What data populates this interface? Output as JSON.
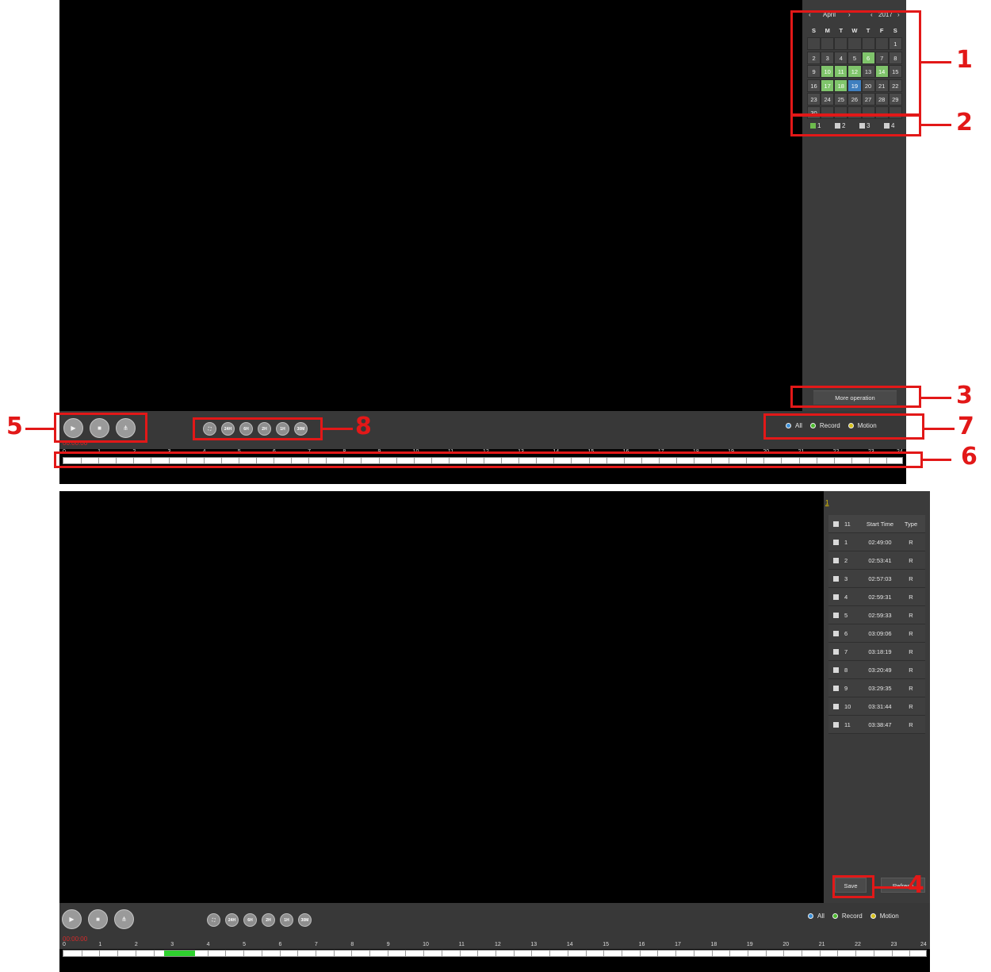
{
  "header_cut_text": "… ‹ … ›",
  "calendar": {
    "month": "April",
    "year": "2017",
    "prev_month": "‹",
    "next_month": "›",
    "prev_year": "‹",
    "next_year": "›",
    "weekdays": [
      "S",
      "M",
      "T",
      "W",
      "T",
      "F",
      "S"
    ],
    "weeks": [
      [
        {
          "d": ""
        },
        {
          "d": ""
        },
        {
          "d": ""
        },
        {
          "d": ""
        },
        {
          "d": ""
        },
        {
          "d": ""
        },
        {
          "d": "1"
        }
      ],
      [
        {
          "d": "2"
        },
        {
          "d": "3"
        },
        {
          "d": "4"
        },
        {
          "d": "5"
        },
        {
          "d": "6",
          "state": "rec"
        },
        {
          "d": "7"
        },
        {
          "d": "8"
        }
      ],
      [
        {
          "d": "9"
        },
        {
          "d": "10",
          "state": "rec"
        },
        {
          "d": "11",
          "state": "rec"
        },
        {
          "d": "12",
          "state": "rec"
        },
        {
          "d": "13"
        },
        {
          "d": "14",
          "state": "rec"
        },
        {
          "d": "15"
        }
      ],
      [
        {
          "d": "16"
        },
        {
          "d": "17",
          "state": "rec"
        },
        {
          "d": "18",
          "state": "rec"
        },
        {
          "d": "19",
          "state": "sel"
        },
        {
          "d": "20"
        },
        {
          "d": "21"
        },
        {
          "d": "22"
        }
      ],
      [
        {
          "d": "23"
        },
        {
          "d": "24"
        },
        {
          "d": "25"
        },
        {
          "d": "26"
        },
        {
          "d": "27"
        },
        {
          "d": "28"
        },
        {
          "d": "29"
        }
      ],
      [
        {
          "d": "30"
        },
        {
          "d": ""
        },
        {
          "d": ""
        },
        {
          "d": ""
        },
        {
          "d": ""
        },
        {
          "d": ""
        },
        {
          "d": ""
        }
      ]
    ]
  },
  "channels": [
    {
      "label": "1",
      "checked": true
    },
    {
      "label": "2",
      "checked": false
    },
    {
      "label": "3",
      "checked": false
    },
    {
      "label": "4",
      "checked": false
    }
  ],
  "more_operation": "More operation",
  "playback_buttons": [
    {
      "name": "play-button",
      "icon": "▶"
    },
    {
      "name": "stop-button",
      "icon": "■"
    },
    {
      "name": "clip-button",
      "icon": "⋔"
    }
  ],
  "zoom_buttons": [
    "⛶",
    "24H",
    "6H",
    "2H",
    "1H",
    "30M"
  ],
  "filters": [
    {
      "label": "All",
      "color": "#3a8fd8"
    },
    {
      "label": "Record",
      "color": "#4cbb2e"
    },
    {
      "label": "Motion",
      "color": "#d8c21a"
    }
  ],
  "timeline": {
    "current_time_top": "00:00:00",
    "current_time_bottom": "00:00:00",
    "hours": [
      "0",
      "1",
      "2",
      "3",
      "4",
      "5",
      "6",
      "7",
      "8",
      "9",
      "10",
      "11",
      "12",
      "13",
      "14",
      "15",
      "16",
      "17",
      "18",
      "19",
      "20",
      "21",
      "22",
      "23",
      "24"
    ],
    "recorded_from_hour": 2.8,
    "recorded_to_hour": 3.65
  },
  "record_list": {
    "page": "1",
    "header": {
      "count": "11",
      "start": "Start Time",
      "type": "Type"
    },
    "rows": [
      {
        "n": "1",
        "time": "02:49:00",
        "type": "R"
      },
      {
        "n": "2",
        "time": "02:53:41",
        "type": "R"
      },
      {
        "n": "3",
        "time": "02:57:03",
        "type": "R"
      },
      {
        "n": "4",
        "time": "02:59:31",
        "type": "R"
      },
      {
        "n": "5",
        "time": "02:59:33",
        "type": "R"
      },
      {
        "n": "6",
        "time": "03:09:06",
        "type": "R"
      },
      {
        "n": "7",
        "time": "03:18:19",
        "type": "R"
      },
      {
        "n": "8",
        "time": "03:20:49",
        "type": "R"
      },
      {
        "n": "9",
        "time": "03:29:35",
        "type": "R"
      },
      {
        "n": "10",
        "time": "03:31:44",
        "type": "R"
      },
      {
        "n": "11",
        "time": "03:38:47",
        "type": "R"
      }
    ],
    "save_label": "Save",
    "refresh_label": "Refresh"
  },
  "annotations": [
    "1",
    "2",
    "3",
    "4",
    "5",
    "6",
    "7",
    "8"
  ],
  "colors": {
    "annotation": "#e21818",
    "record": "#7fc46b",
    "selected": "#3f7fbf"
  }
}
